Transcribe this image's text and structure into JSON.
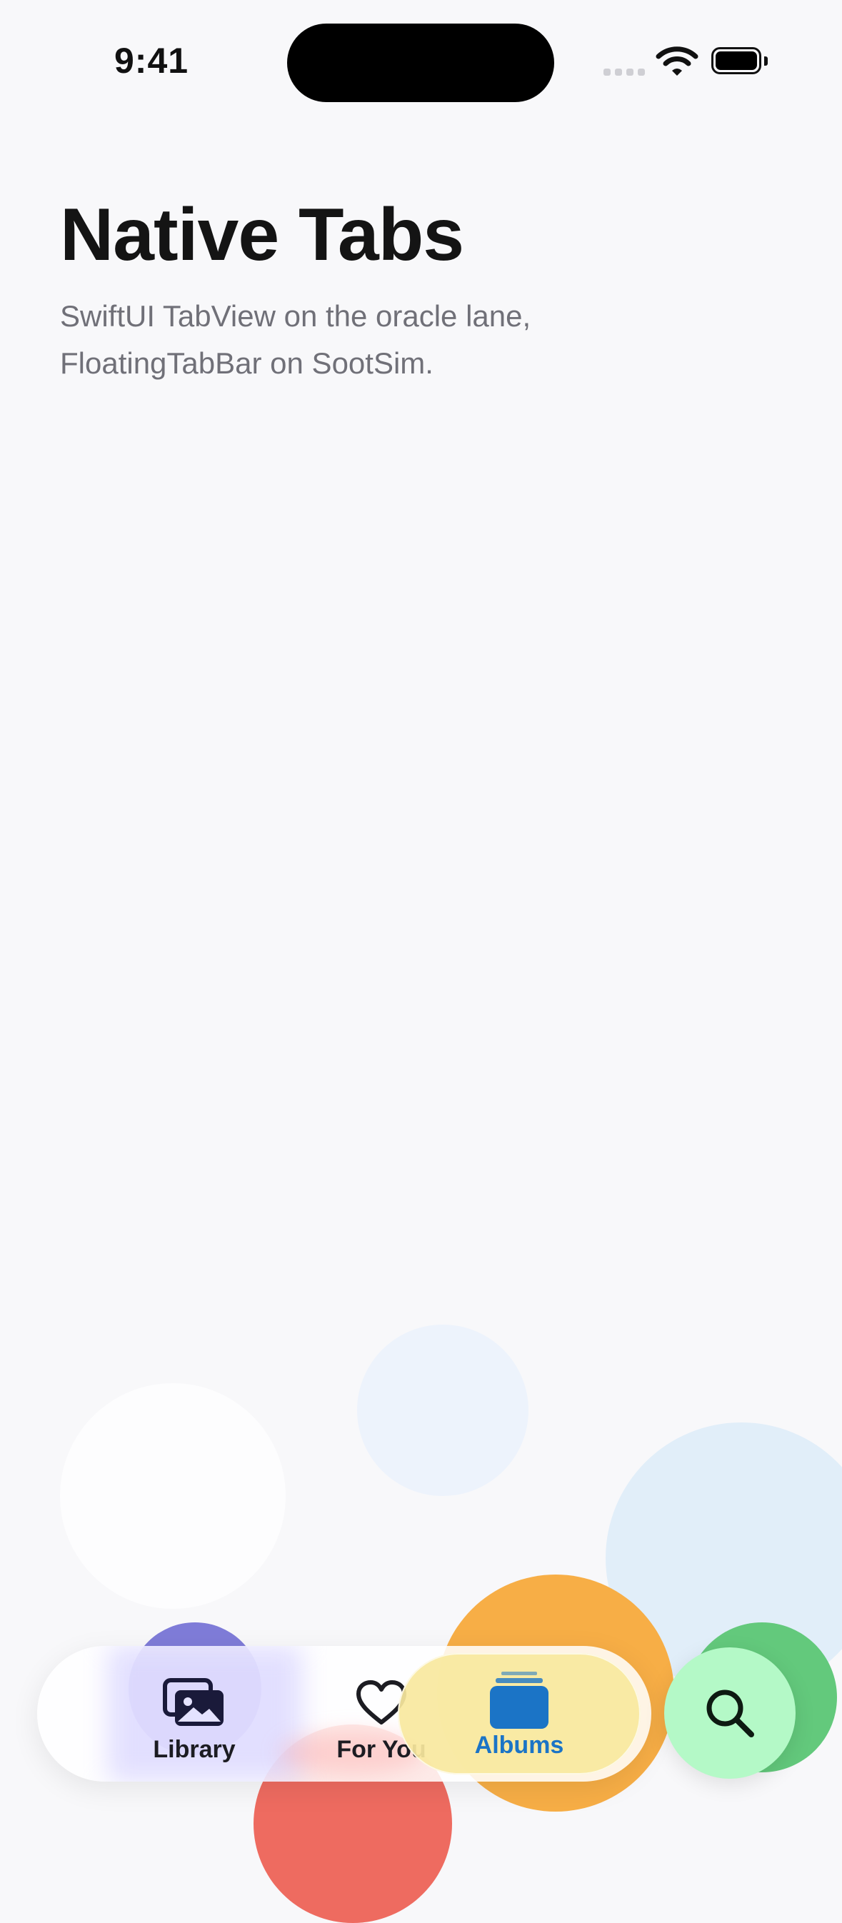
{
  "status_bar": {
    "time": "9:41"
  },
  "header": {
    "title": "Native Tabs",
    "subtitle": "SwiftUI TabView on the oracle lane, FloatingTabBar on SootSim."
  },
  "tab_bar": {
    "selected": "Albums",
    "tabs": [
      {
        "label": "Library",
        "icon": "photo-stack-icon"
      },
      {
        "label": "For You",
        "icon": "heart-icon"
      },
      {
        "label": "Albums",
        "icon": "album-stack-icon"
      }
    ],
    "search": {
      "icon": "search-icon"
    }
  },
  "colors": {
    "background": "#f8f8fa",
    "accent": "#1b74c6",
    "albums_highlight": "#f8e89e",
    "search_button": "#b4f9c7"
  }
}
